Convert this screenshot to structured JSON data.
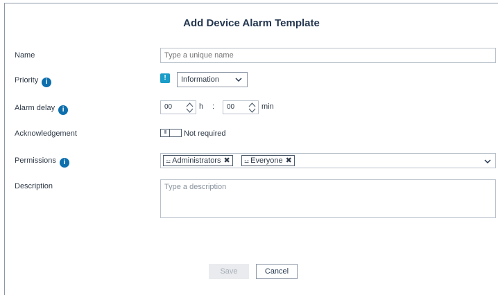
{
  "dialog": {
    "title": "Add Device Alarm Template"
  },
  "name": {
    "label": "Name",
    "placeholder": "Type a unique name",
    "value": ""
  },
  "priority": {
    "label": "Priority",
    "icon": "information-severity-icon",
    "selected": "Information"
  },
  "alarm_delay": {
    "label": "Alarm delay",
    "hours": "00",
    "hours_unit": "h",
    "separator": ":",
    "minutes": "00",
    "minutes_unit": "min"
  },
  "acknowledgement": {
    "label": "Acknowledgement",
    "toggle_knob": "III",
    "state": "Not required"
  },
  "permissions": {
    "label": "Permissions",
    "tags": [
      "Administrators",
      "Everyone"
    ],
    "tag_icon": "⚍"
  },
  "description": {
    "label": "Description",
    "placeholder": "Type a description"
  },
  "buttons": {
    "save": "Save",
    "cancel": "Cancel"
  },
  "info_glyph": "i",
  "colors": {
    "accent": "#0e6fad",
    "severity": "#1a9dc8",
    "title": "#24364f"
  }
}
